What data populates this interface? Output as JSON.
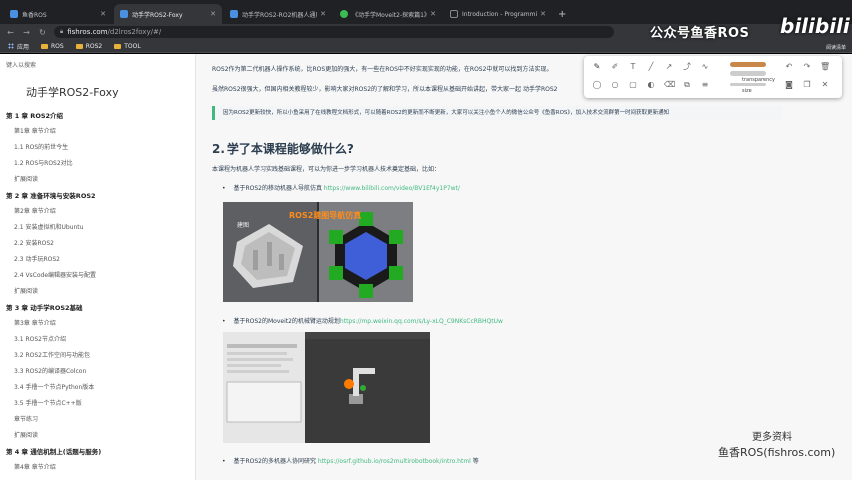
{
  "tabs": [
    {
      "label": "鱼香ROS",
      "favicon_color": "#4a90e2",
      "active": false
    },
    {
      "label": "动手学ROS2-Foxy",
      "favicon_color": "#4a90e2",
      "active": true
    },
    {
      "label": "动手学ROS2-RO2机器人通用的",
      "favicon_color": "#4a90e2",
      "active": false
    },
    {
      "label": "《动手学Moveit2-探索篇1》U...",
      "favicon_color": "#3cba54",
      "active": false
    },
    {
      "label": "Introduction - Programming M...",
      "favicon_color": "#222222",
      "active": false
    }
  ],
  "address": {
    "domain": "fishros.com",
    "path": "/d2lros2foxy/#/"
  },
  "bookmarks": [
    {
      "label": "应用",
      "icon": "apps-grid-icon"
    },
    {
      "label": "ROS",
      "icon": "folder-icon"
    },
    {
      "label": "ROS2",
      "icon": "folder-icon"
    },
    {
      "label": "TOOL",
      "icon": "folder-icon"
    }
  ],
  "reading_mode": "阅读清单",
  "watermark_top": "公众号鱼香ROS",
  "bili": "bilibili",
  "sidebar": {
    "search_placeholder": "键入以搜索",
    "site_title": "动手学ROS2-Foxy",
    "toc": [
      {
        "label": "第 1 章 ROS2介绍",
        "level": "chapter"
      },
      {
        "label": "第1章 章节介绍",
        "level": "sub"
      },
      {
        "label": "1.1 ROS的前世今生",
        "level": "sub"
      },
      {
        "label": "1.2 ROS与ROS2对比",
        "level": "sub"
      },
      {
        "label": "扩展阅读",
        "level": "sub"
      },
      {
        "label": "第 2 章 准备环境与安装ROS2",
        "level": "chapter"
      },
      {
        "label": "第2章 章节介绍",
        "level": "sub"
      },
      {
        "label": "2.1 安装虚拟机和Ubuntu",
        "level": "sub"
      },
      {
        "label": "2.2 安装ROS2",
        "level": "sub"
      },
      {
        "label": "2.3 动手玩ROS2",
        "level": "sub"
      },
      {
        "label": "2.4 VsCode编辑器安装与配置",
        "level": "sub"
      },
      {
        "label": "扩展阅读",
        "level": "sub"
      },
      {
        "label": "第 3 章 动手学ROS2基础",
        "level": "chapter"
      },
      {
        "label": "第3章 章节介绍",
        "level": "sub"
      },
      {
        "label": "3.1 ROS2节点介绍",
        "level": "sub"
      },
      {
        "label": "3.2 ROS2工作空间与功能包",
        "level": "sub"
      },
      {
        "label": "3.3 ROS2的编译器Colcon",
        "level": "sub"
      },
      {
        "label": "3.4 手撸一个节点Python版本",
        "level": "sub"
      },
      {
        "label": "3.5 手撸一个节点C++版",
        "level": "sub"
      },
      {
        "label": "章节练习",
        "level": "sub"
      },
      {
        "label": "扩展阅读",
        "level": "sub"
      },
      {
        "label": "第 4 章 通信机制上(话题与服务)",
        "level": "chapter"
      },
      {
        "label": "第4章 章节介绍",
        "level": "sub"
      }
    ]
  },
  "content": {
    "para1": "ROS2作为第二代机器人操作系统，比ROS更加的强大，有一些在ROS中不好实现实现的功能，在ROS2中就可以找到方法实现。",
    "para2": "虽然ROS2很强大，但国内相关教程较少，影响大家对ROS2的了解和学习，所以本课程从基础开始讲起，带大家一起 动手学ROS2",
    "tip": "因为ROS2更新较快，所以小鱼采用了在线教程文档形式，可以随着ROS2的更新而不断更新，大家可以关注小鱼个人的微信公众号《鱼香ROS》，加入技术交流群第一时间获取更新通知",
    "heading_num": "2.",
    "heading": "学了本课程能够做什么?",
    "intro": "本课程为机器人学习实践基础课程，可以为你进一步学习机器人技术奠定基础，比如：",
    "bullet1_text": "基于ROS2的移动机器人导航仿真 ",
    "bullet1_link": "https://www.bilibili.com/video/BV1Ef4y1P7wt/",
    "img1_caption": "ROS2建图导航仿真",
    "img1_label": "建图",
    "bullet2_text": "基于ROS2的Moveit2的机械臂运动规划",
    "bullet2_link": "https://mp.weixin.qq.com/s/Ly-xLQ_C9NKsCcRBHQtUw",
    "bullet3_text": "基于ROS2的多机器人协同研究 ",
    "bullet3_link": "https://osrf.github.io/ros2multirobotbook/intro.html",
    "bullet3_suffix": " 等"
  },
  "annotation_toolbar": {
    "transparency_label": "transparency",
    "size_label": "size",
    "accent_color": "#c8884a"
  },
  "overlay": {
    "more": "更多资料",
    "site": "鱼香ROS(fishros.com)"
  }
}
